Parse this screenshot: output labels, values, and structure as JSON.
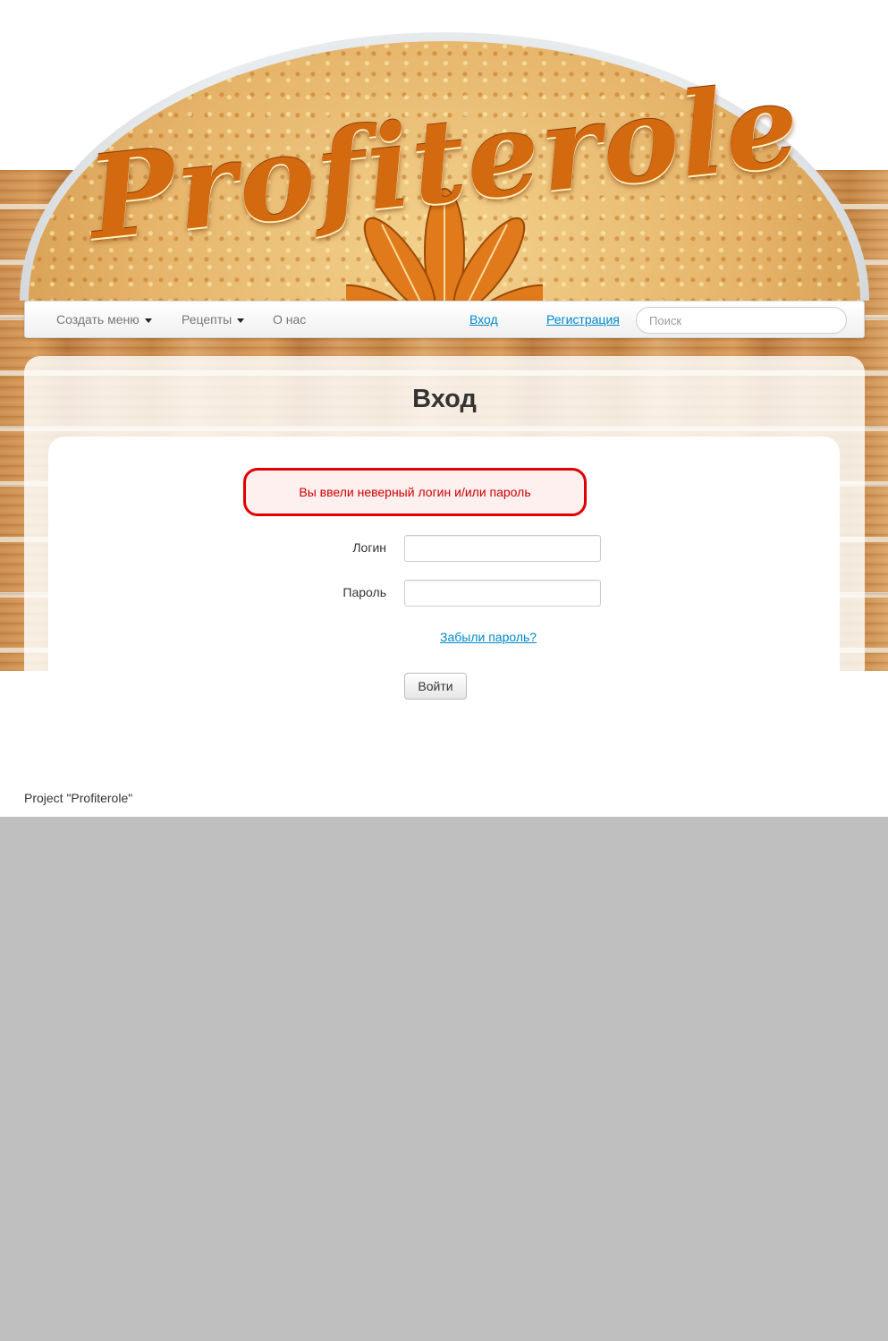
{
  "header": {
    "logo_text": "Profiterole"
  },
  "nav": {
    "items": [
      {
        "label": "Создать меню",
        "has_caret": true
      },
      {
        "label": "Рецепты",
        "has_caret": true
      },
      {
        "label": "О нас",
        "has_caret": false
      }
    ],
    "login_link": "Вход",
    "register_link": "Регистрация",
    "search_placeholder": "Поиск"
  },
  "main": {
    "title": "Вход",
    "error_message": "Вы ввели неверный логин и/или пароль",
    "login_label": "Логин",
    "login_value": "",
    "password_label": "Пароль",
    "password_value": "",
    "forgot_password": "Забыли пароль?",
    "submit_label": "Войти"
  },
  "footer": {
    "text": "Project \"Profiterole\""
  },
  "colors": {
    "link": "#0088cc",
    "error": "#e00000",
    "background": "#bfbfbf"
  }
}
